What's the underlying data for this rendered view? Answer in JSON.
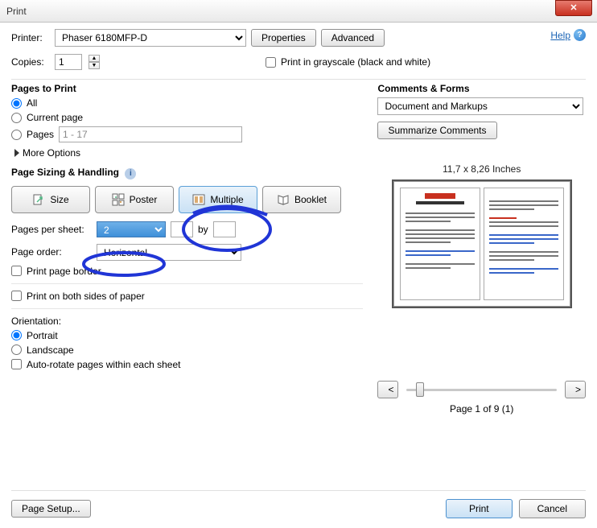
{
  "window": {
    "title": "Print"
  },
  "top": {
    "printer_label": "Printer:",
    "printer_value": "Phaser 6180MFP-D",
    "properties_btn": "Properties",
    "advanced_btn": "Advanced",
    "help_label": "Help",
    "copies_label": "Copies:",
    "copies_value": "1",
    "grayscale_label": "Print in grayscale (black and white)"
  },
  "pages_to_print": {
    "title": "Pages to Print",
    "all": "All",
    "current": "Current page",
    "pages": "Pages",
    "pages_range": "1 - 17",
    "more_options": "More Options"
  },
  "sizing": {
    "title": "Page Sizing & Handling",
    "size": "Size",
    "poster": "Poster",
    "multiple": "Multiple",
    "booklet": "Booklet",
    "pps_label": "Pages per sheet:",
    "pps_value": "2",
    "by": "by",
    "order_label": "Page order:",
    "order_value": "Horizontal",
    "border": "Print page border",
    "both_sides": "Print on both sides of paper",
    "orientation_label": "Orientation:",
    "portrait": "Portrait",
    "landscape": "Landscape",
    "autorotate": "Auto-rotate pages within each sheet"
  },
  "comments": {
    "title": "Comments & Forms",
    "dropdown": "Document and Markups",
    "summarize": "Summarize Comments"
  },
  "preview": {
    "dims": "11,7 x 8,26 Inches",
    "nav_prev": "<",
    "nav_next": ">",
    "page_of": "Page 1 of 9 (1)"
  },
  "buttons": {
    "page_setup": "Page Setup...",
    "print": "Print",
    "cancel": "Cancel"
  }
}
